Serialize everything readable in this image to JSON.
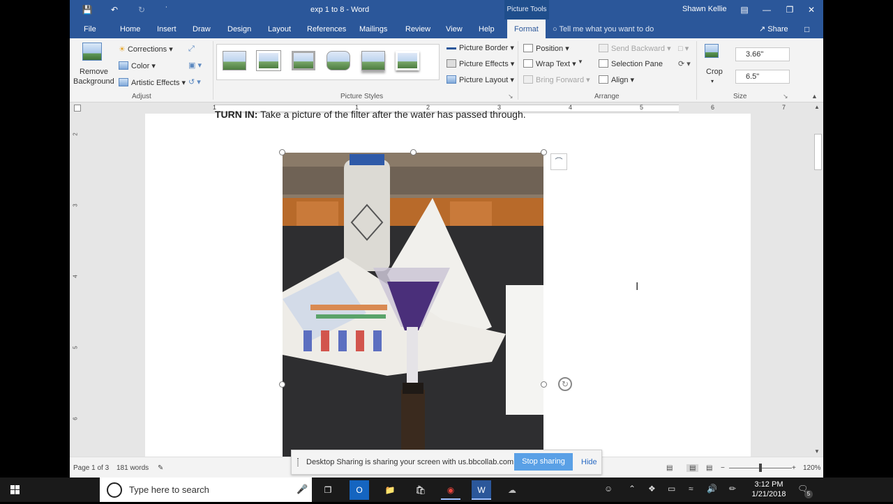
{
  "window": {
    "doc_title": "exp 1 to 8  -  Word",
    "picture_tools": "Picture Tools",
    "user": "Shawn Kellie"
  },
  "tabs": [
    "File",
    "Home",
    "Insert",
    "Draw",
    "Design",
    "Layout",
    "References",
    "Mailings",
    "Review",
    "View",
    "Help",
    "Format"
  ],
  "active_tab": "Format",
  "tell_me": "Tell me what you want to do",
  "share": "Share",
  "ribbon": {
    "adjust": {
      "remove_background_1": "Remove",
      "remove_background_2": "Background",
      "corrections": "Corrections",
      "color": "Color",
      "artistic_effects": "Artistic Effects",
      "label": "Adjust"
    },
    "picture_styles": {
      "border": "Picture Border",
      "effects": "Picture Effects",
      "layout": "Picture Layout",
      "label": "Picture Styles"
    },
    "arrange": {
      "position": "Position",
      "wrap_text": "Wrap Text",
      "bring_forward": "Bring Forward",
      "send_backward": "Send Backward",
      "selection_pane": "Selection Pane",
      "align": "Align",
      "label": "Arrange"
    },
    "size": {
      "crop": "Crop",
      "height": "3.66\"",
      "width": "6.5\"",
      "label": "Size"
    }
  },
  "ruler_numbers": [
    "1",
    "1",
    "2",
    "3",
    "4",
    "5",
    "6",
    "7"
  ],
  "vruler_numbers": [
    "2",
    "3",
    "4",
    "5",
    "6"
  ],
  "document": {
    "turn_in": "TURN IN:",
    "instruction": " Take a picture of the filter after the water has passed through."
  },
  "status": {
    "page": "Page 1 of 3",
    "words": "181 words",
    "zoom": "120%"
  },
  "sharing_bar": {
    "message": "Desktop Sharing is sharing your screen with us.bbcollab.com.",
    "stop": "Stop sharing",
    "hide": "Hide"
  },
  "taskbar": {
    "search_placeholder": "Type here to search",
    "time": "3:12 PM",
    "date": "1/21/2018",
    "notifications": "5"
  },
  "colors": {
    "word_blue": "#2b579a",
    "ribbon_bg": "#f3f3f3",
    "stop_button": "#5aa0e6"
  }
}
